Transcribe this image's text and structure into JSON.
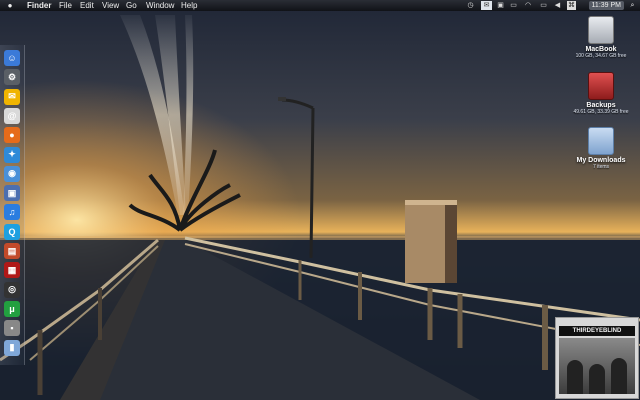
{
  "menubar": {
    "apple_icon": "apple-icon",
    "app_name": "Finder",
    "items": [
      "File",
      "Edit",
      "View",
      "Go",
      "Window",
      "Help"
    ],
    "status_icons": [
      "timemachine-icon",
      "mail-icon",
      "spaces-icon",
      "wifi-icon",
      "battery-icon",
      "volume-icon",
      "input-menu-icon",
      "user-icon"
    ],
    "clock": "11:39 PM",
    "spotlight_icon": "spotlight-icon"
  },
  "dock": {
    "items": [
      {
        "name": "finder",
        "icon": "finder-icon",
        "color": "#3b7ad8",
        "glyph": "☺"
      },
      {
        "name": "system-preferences",
        "icon": "gear-icon",
        "color": "#5a5f66",
        "glyph": "⚙"
      },
      {
        "name": "mail",
        "icon": "mail-icon",
        "color": "#f0b400",
        "glyph": "✉"
      },
      {
        "name": "address-book",
        "icon": "address-book-icon",
        "color": "#d9d9d9",
        "glyph": "@"
      },
      {
        "name": "firefox",
        "icon": "firefox-icon",
        "color": "#e66b1a",
        "glyph": "●"
      },
      {
        "name": "safari",
        "icon": "safari-icon",
        "color": "#2e8ad8",
        "glyph": "✦"
      },
      {
        "name": "web-browser",
        "icon": "globe-icon",
        "color": "#4a90d8",
        "glyph": "◉"
      },
      {
        "name": "preview",
        "icon": "preview-icon",
        "color": "#4c6fb0",
        "glyph": "▣"
      },
      {
        "name": "itunes",
        "icon": "music-note-icon",
        "color": "#2a7de0",
        "glyph": "♫"
      },
      {
        "name": "quicktime",
        "icon": "quicktime-icon",
        "color": "#1ea0e0",
        "glyph": "Q"
      },
      {
        "name": "photos",
        "icon": "photo-icon",
        "color": "#c24a2a",
        "glyph": "▤"
      },
      {
        "name": "photo-booth",
        "icon": "photo-booth-icon",
        "color": "#b01818",
        "glyph": "▦"
      },
      {
        "name": "camera",
        "icon": "camera-icon",
        "color": "#333",
        "glyph": "◎"
      },
      {
        "name": "utorrent",
        "icon": "utorrent-icon",
        "color": "#22a040",
        "glyph": "μ"
      },
      {
        "name": "utility",
        "icon": "utility-icon",
        "color": "#888",
        "glyph": "▪"
      },
      {
        "name": "documents-stack",
        "icon": "stack-icon",
        "color": "#7fa7d8",
        "glyph": "▮"
      }
    ]
  },
  "desktop_icons": [
    {
      "label": "MacBook",
      "sub": "100 GB, 34.67 GB free",
      "icon": "internal-drive-icon",
      "color": "#c8ccd2"
    },
    {
      "label": "Backups",
      "sub": "49.61 GB, 33.39 GB free",
      "icon": "external-drive-icon",
      "color": "#c23636"
    },
    {
      "label": "My Downloads",
      "sub": "7 items",
      "icon": "downloads-folder-icon",
      "color": "#9bb8dc"
    }
  ],
  "album": {
    "title": "THIRDEYEBLIND",
    "icon": "album-art-widget"
  }
}
